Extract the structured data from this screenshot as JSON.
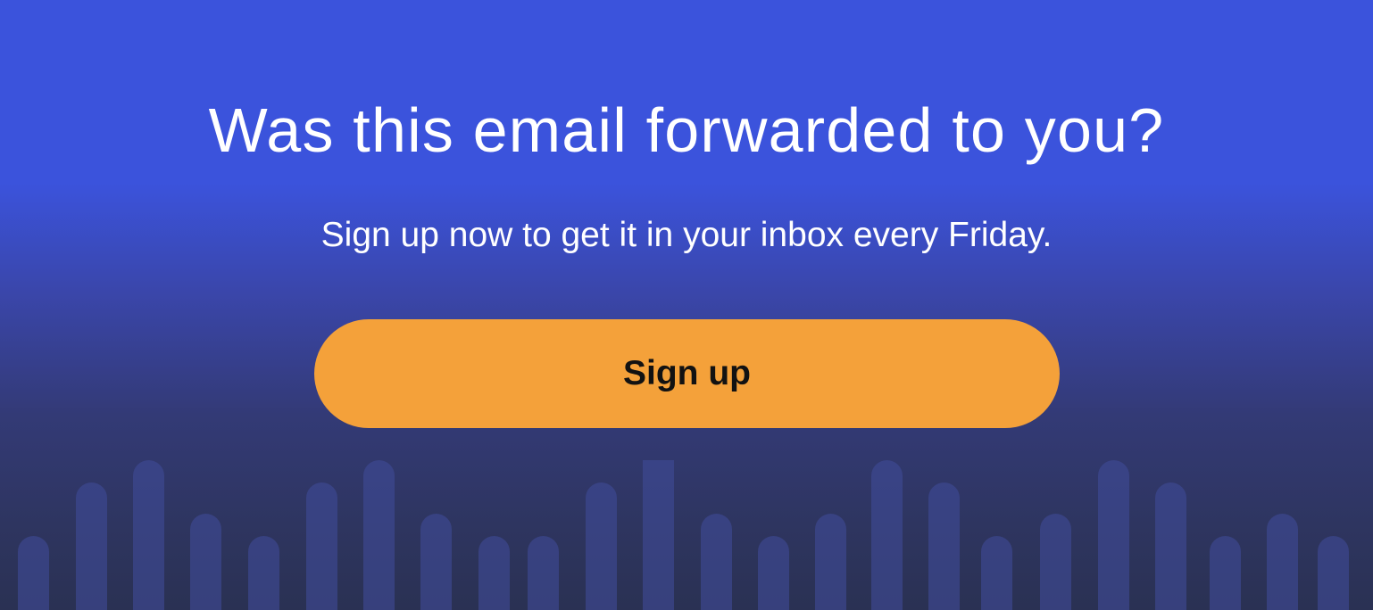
{
  "banner": {
    "headline": "Was this email forwarded to you?",
    "subline": "Sign up now to get it in your inbox every Friday.",
    "cta_label": "Sign up"
  },
  "colors": {
    "background_top": "#3b53dc",
    "background_bottom": "#2a3153",
    "button": "#f4a13a",
    "button_text": "#121212",
    "text": "#ffffff"
  }
}
